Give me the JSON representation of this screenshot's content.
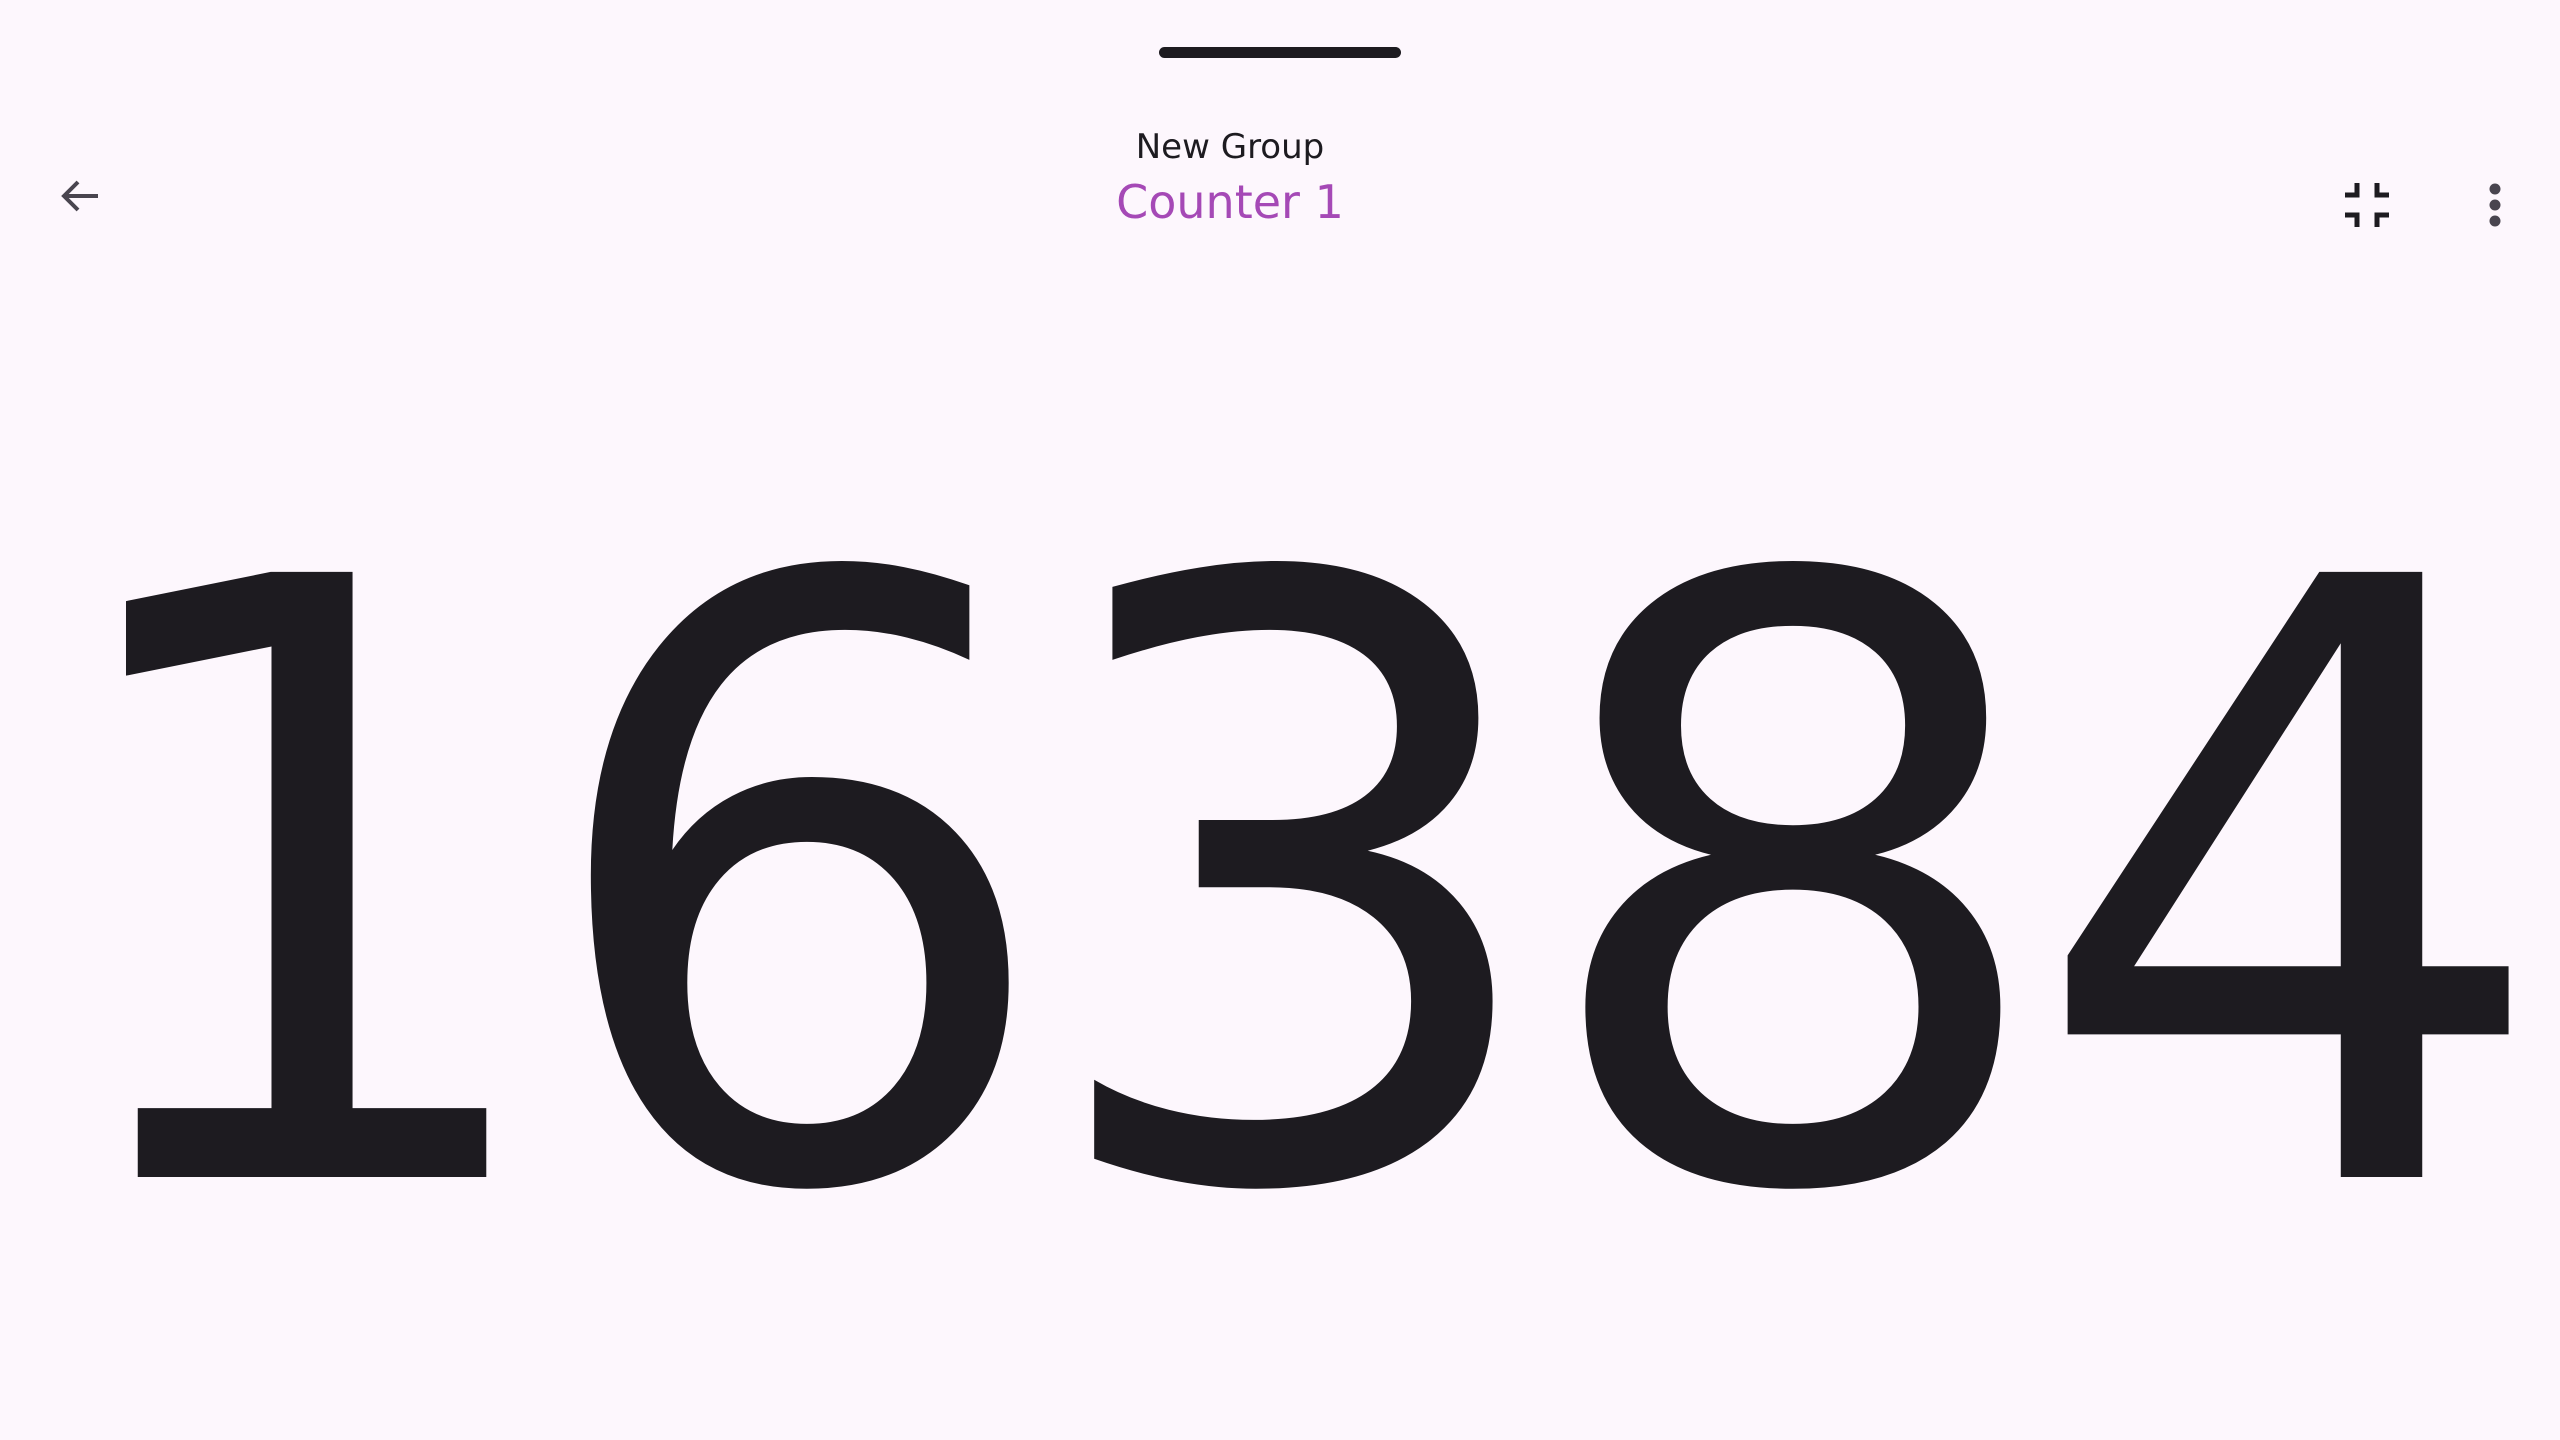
{
  "header": {
    "group_name": "New Group",
    "counter_name": "Counter 1",
    "back_icon": "arrow-back-icon",
    "exit_fullscreen_icon": "fullscreen-exit-icon",
    "more_icon": "more-vert-icon"
  },
  "counter": {
    "value": "16384"
  },
  "colors": {
    "background": "#FDF7FD",
    "text": "#1D1B20",
    "accent": "#A549B6",
    "icon": "#49454F"
  }
}
